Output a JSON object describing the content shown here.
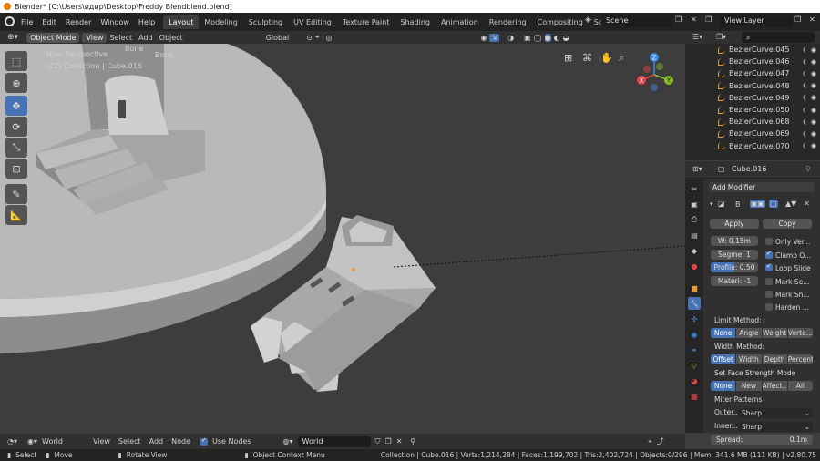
{
  "window_title": "Blender* [C:\\Users\\идир\\Desktop\\Freddy Blendblend.blend]",
  "menu": [
    "File",
    "Edit",
    "Render",
    "Window",
    "Help"
  ],
  "workspaces": [
    "Layout",
    "Modeling",
    "Sculpting",
    "UV Editing",
    "Texture Paint",
    "Shading",
    "Animation",
    "Rendering",
    "Compositing",
    "Scripting"
  ],
  "scene": "Scene",
  "view_layer": "View Layer",
  "viewport_header": {
    "mode": "Object Mode",
    "view": "View",
    "select": "Select",
    "add": "Add",
    "object": "Object",
    "orientation": "Global"
  },
  "viewport_overlay": {
    "perspective": "User Perspective",
    "collection": "(22) Collection | Cube.016",
    "bone1": "Bone",
    "bone2": "Bone"
  },
  "gizmo": {
    "x": "X",
    "y": "Y",
    "z": "Z"
  },
  "colors": {
    "x": "#e8434a",
    "y": "#8bbf2a",
    "z": "#3c8ce6",
    "accent": "#4772b3",
    "curve": "#e49b3c"
  },
  "outliner_items": [
    "BezierCurve.045",
    "BezierCurve.046",
    "BezierCurve.047",
    "BezierCurve.048",
    "BezierCurve.049",
    "BezierCurve.050",
    "BezierCurve.068",
    "BezierCurve.069",
    "BezierCurve.070"
  ],
  "properties": {
    "object_name": "Cube.016",
    "add_modifier": "Add Modifier",
    "modifier_initial": "B",
    "apply": "Apply",
    "copy": "Copy",
    "width": "W: 0.15m",
    "segments": "Segme: 1",
    "profile": "Profile: 0.50",
    "material": "Materi: -1",
    "only_vertices": "Only Ver...",
    "clamp": "Clamp O...",
    "loop_slide": "Loop Slide",
    "mark_seam": "Mark Se...",
    "mark_sharp": "Mark Sh...",
    "harden": "Harden ...",
    "limit_method_label": "Limit Method:",
    "limit_methods": [
      "None",
      "Angle",
      "Weight",
      "Verte..."
    ],
    "width_method_label": "Width Method:",
    "width_methods": [
      "Offset",
      "Width",
      "Depth",
      "Percent"
    ],
    "face_strength_label": "Set Face Strength Mode",
    "face_strength": [
      "None",
      "New",
      "Affect...",
      "All"
    ],
    "miter_label": "Miter Patterns",
    "outer_label": "Outer...",
    "outer_value": "Sharp",
    "inner_label": "Inner...",
    "inner_value": "Sharp",
    "spread_label": "Spread:",
    "spread_value": "0.1m"
  },
  "node_header": {
    "world": "World",
    "view": "View",
    "select": "Select",
    "add": "Add",
    "node": "Node",
    "use_nodes": "Use Nodes",
    "world_field": "World"
  },
  "status": {
    "select": "Select",
    "move": "Move",
    "rotate": "Rotate View",
    "context": "Object Context Menu",
    "stats": "Collection | Cube.016 | Verts:1,214,284 | Faces:1,199,702 | Tris:2,402,724 | Objects:0/296 | Mem: 341.6 MB (111 KB) | v2.80.75"
  }
}
